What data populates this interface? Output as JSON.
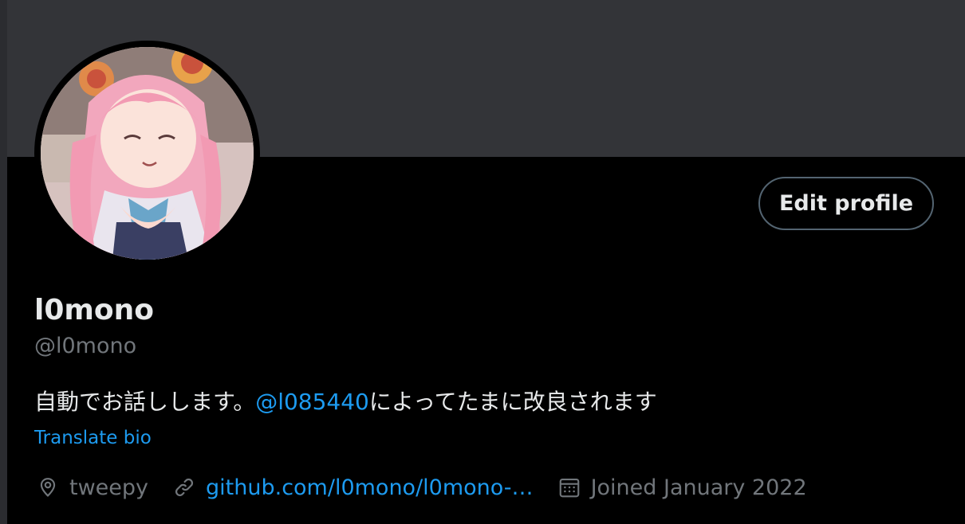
{
  "profile": {
    "display_name": "l0mono",
    "handle": "@l0mono",
    "edit_button_label": "Edit profile",
    "bio": {
      "text_before": "自動でお話しします。",
      "mention": "@l085440",
      "text_after": "によってたまに改良されます"
    },
    "translate_label": "Translate bio",
    "meta": {
      "location": "tweepy",
      "location_icon": "location-pin-icon",
      "website": "github.com/l0mono/l0mono-…",
      "website_icon": "link-icon",
      "joined": "Joined January 2022",
      "joined_icon": "calendar-icon"
    }
  },
  "colors": {
    "background": "#000000",
    "banner": "#333438",
    "text_primary": "#e7e9ea",
    "text_secondary": "#71767b",
    "accent": "#1d9bf0",
    "button_border": "#536471"
  }
}
